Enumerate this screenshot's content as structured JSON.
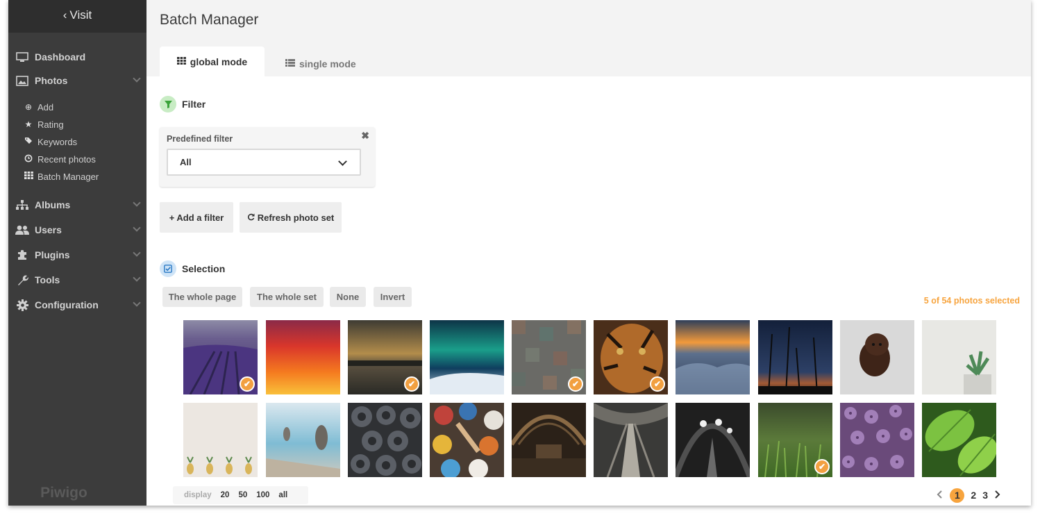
{
  "sidebar": {
    "visit_label": "Visit",
    "nav": [
      {
        "label": "Dashboard",
        "icon": "monitor-icon",
        "has_caret": false
      },
      {
        "label": "Photos",
        "icon": "image-icon",
        "has_caret": true
      },
      {
        "label": "Albums",
        "icon": "sitemap-icon",
        "has_caret": true
      },
      {
        "label": "Users",
        "icon": "users-icon",
        "has_caret": true
      },
      {
        "label": "Plugins",
        "icon": "puzzle-icon",
        "has_caret": true
      },
      {
        "label": "Tools",
        "icon": "wrench-icon",
        "has_caret": true
      },
      {
        "label": "Configuration",
        "icon": "gear-icon",
        "has_caret": true
      }
    ],
    "photos_sub": [
      {
        "label": "Add",
        "icon": "plus-circle-icon"
      },
      {
        "label": "Rating",
        "icon": "star-icon"
      },
      {
        "label": "Keywords",
        "icon": "tags-icon"
      },
      {
        "label": "Recent photos",
        "icon": "clock-icon"
      },
      {
        "label": "Batch Manager",
        "icon": "grid-icon"
      }
    ],
    "brand": "Piwigo"
  },
  "header": {
    "title": "Batch Manager",
    "tabs": [
      {
        "label": "global mode",
        "active": true
      },
      {
        "label": "single mode",
        "active": false
      }
    ]
  },
  "filter": {
    "heading": "Filter",
    "predefined_label": "Predefined filter",
    "predefined_value": "All",
    "add_filter": "+ Add a filter",
    "refresh": "Refresh photo set"
  },
  "selection": {
    "heading": "Selection",
    "buttons": [
      "The whole page",
      "The whole set",
      "None",
      "Invert"
    ],
    "count_text": "5 of 54 photos selected"
  },
  "thumbnails": [
    {
      "subject": "lavender field",
      "selected": true
    },
    {
      "subject": "red sunset sky",
      "selected": false
    },
    {
      "subject": "harbor at dusk",
      "selected": true
    },
    {
      "subject": "aurora borealis",
      "selected": false
    },
    {
      "subject": "colored tiles",
      "selected": true
    },
    {
      "subject": "tiger face",
      "selected": true
    },
    {
      "subject": "misty mountain sunrise",
      "selected": false
    },
    {
      "subject": "silhouette at twilight",
      "selected": false
    },
    {
      "subject": "brown puppy",
      "selected": false
    },
    {
      "subject": "succulent plant",
      "selected": false
    },
    {
      "subject": "pineapples",
      "selected": false
    },
    {
      "subject": "pelicans on pier",
      "selected": false
    },
    {
      "subject": "paint pots",
      "selected": false
    },
    {
      "subject": "paint cups and brush",
      "selected": false
    },
    {
      "subject": "train station hall",
      "selected": false
    },
    {
      "subject": "escalators",
      "selected": false
    },
    {
      "subject": "tunnel with lamps",
      "selected": false
    },
    {
      "subject": "grass close-up",
      "selected": true
    },
    {
      "subject": "lilac flowers",
      "selected": false
    },
    {
      "subject": "green leaves",
      "selected": false
    }
  ],
  "display": {
    "label": "display",
    "options": [
      "20",
      "50",
      "100",
      "all"
    ]
  },
  "pagination": {
    "pages": [
      "1",
      "2",
      "3"
    ],
    "current": "1"
  },
  "colors": {
    "accent": "#f7a43e",
    "sidebar_bg": "#3c3c3c",
    "filter_icon_bg": "#c8ecc4",
    "selection_icon_bg": "#cfe4f7"
  }
}
